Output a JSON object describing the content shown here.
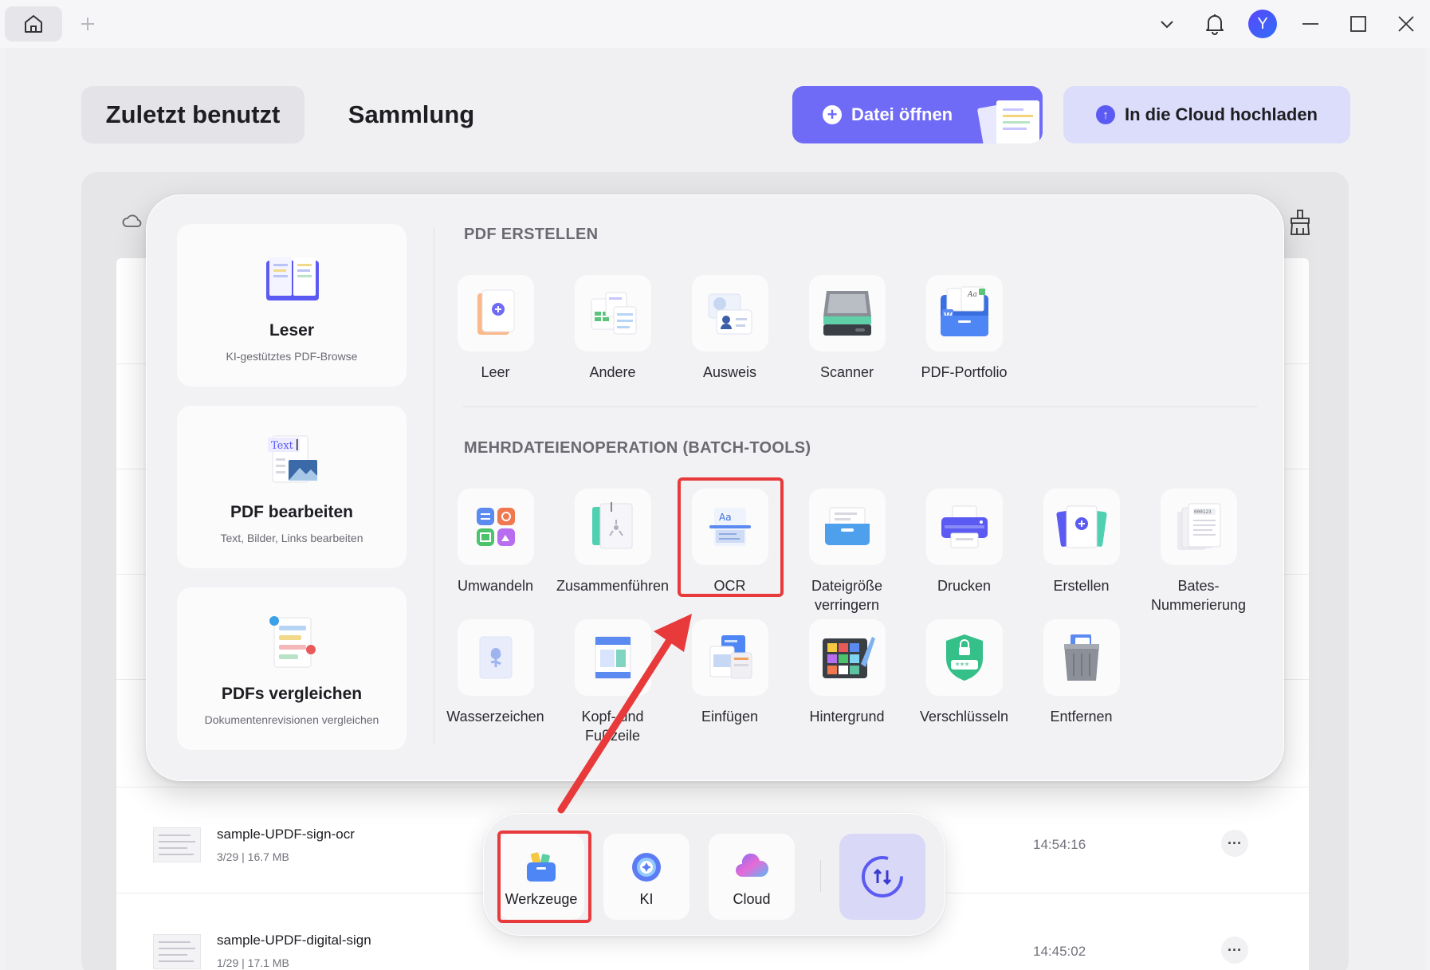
{
  "titlebar": {
    "home_icon": "home-icon",
    "new_tab_icon": "plus-icon",
    "dropdown_icon": "chevron-down-icon",
    "bell_icon": "bell-icon",
    "avatar_initial": "Y",
    "minimize_icon": "minimize-icon",
    "maximize_icon": "maximize-icon",
    "close_icon": "close-icon"
  },
  "header": {
    "tab_recent": "Zuletzt benutzt",
    "tab_collection": "Sammlung",
    "open_file": "Datei öffnen",
    "upload_cloud": "In die Cloud hochladen"
  },
  "features": [
    {
      "title": "Leser",
      "subtitle": "KI-gestütztes PDF-Browse"
    },
    {
      "title": "PDF bearbeiten",
      "subtitle": "Text, Bilder, Links bearbeiten"
    },
    {
      "title": "PDFs vergleichen",
      "subtitle": "Dokumentenrevisionen vergleichen"
    }
  ],
  "create_section": {
    "title": "PDF ERSTELLEN",
    "tools": [
      "Leer",
      "Andere",
      "Ausweis",
      "Scanner",
      "PDF-Portfolio"
    ]
  },
  "batch_section": {
    "title": "MEHRDATEIENOPERATION (BATCH-TOOLS)",
    "tools": [
      "Umwandeln",
      "Zusammenführen",
      "OCR",
      "Dateigröße verringern",
      "Drucken",
      "Erstellen",
      "Bates-Nummerierung",
      "Wasserzeichen",
      "Kopf- und Fußzeile",
      "Einfügen",
      "Hintergrund",
      "Verschlüsseln",
      "Entfernen"
    ]
  },
  "files": [
    {
      "name": "sample-UPDF-sign-ocr",
      "meta": "3/29 | 16.7 MB",
      "time": "14:54:16",
      "more": "···"
    },
    {
      "name": "sample-UPDF-digital-sign",
      "meta": "1/29 | 17.1 MB",
      "time": "14:45:02",
      "more": "···"
    }
  ],
  "dock": {
    "tools": "Werkzeuge",
    "ai": "KI",
    "cloud": "Cloud"
  },
  "accent": {
    "primary": "#6f6bf6",
    "highlight": "#e8393b"
  }
}
